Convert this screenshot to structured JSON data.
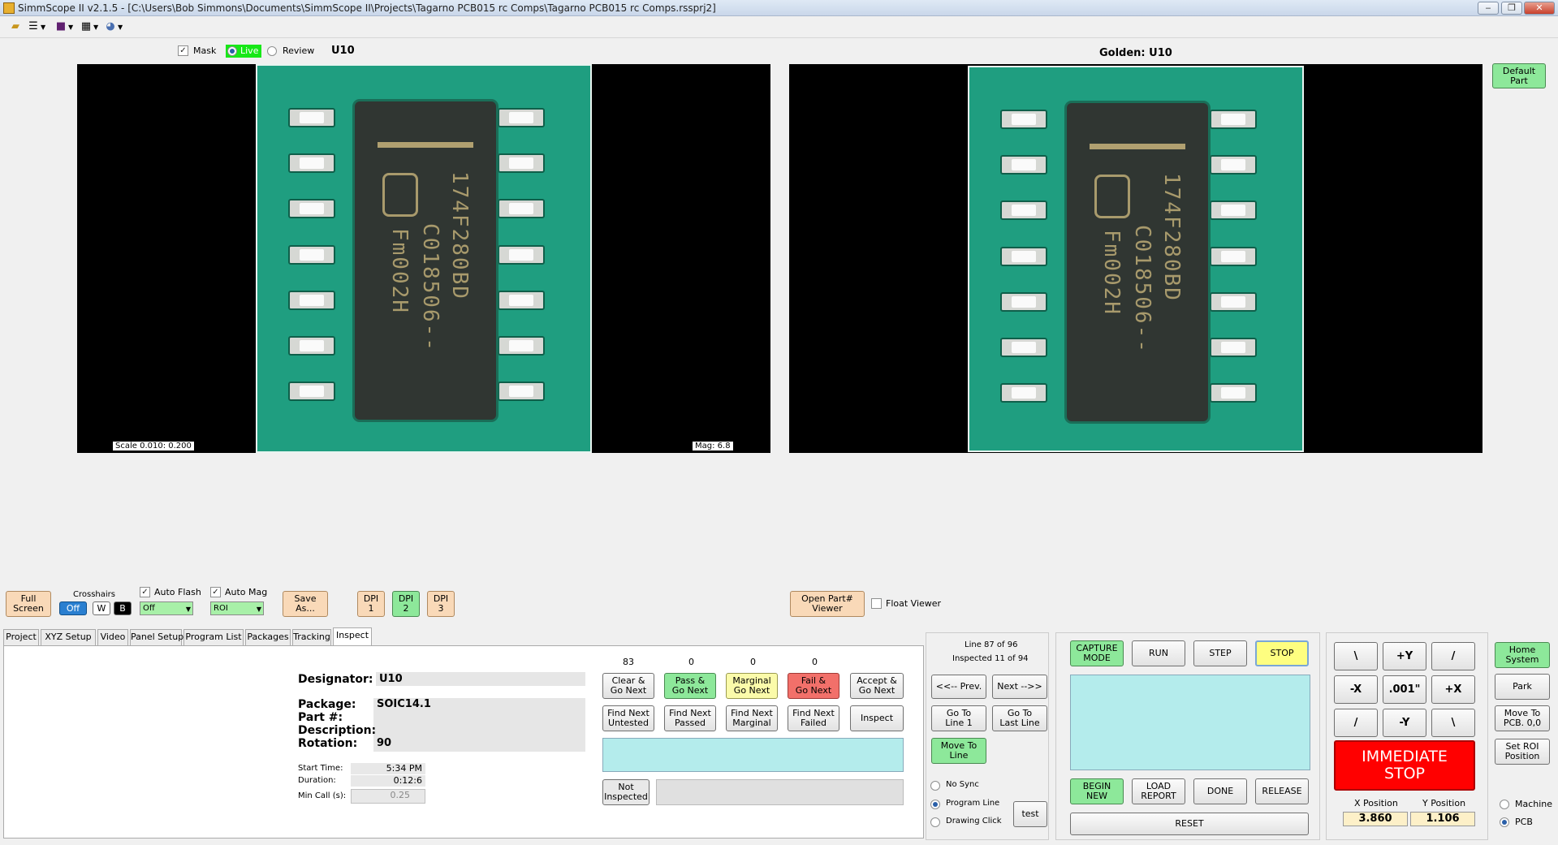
{
  "window": {
    "title": "SimmScope II  v2.1.5 - [C:\\Users\\Bob Simmons\\Documents\\SimmScope II\\Projects\\Tagarno PCB015 rc Comps\\Tagarno PCB015 rc Comps.rssprj2]",
    "minimize": "‒",
    "restore": "❐",
    "close": "✕"
  },
  "toolbar": {
    "icons": [
      "folder-open-icon",
      "checklist-icon",
      "camera-icon",
      "grid-icon",
      "globe-icon"
    ]
  },
  "live_view": {
    "mask_label": "Mask",
    "live_label": "Live",
    "review_label": "Review",
    "designator": "U10",
    "scale": "Scale 0.010:  0.200",
    "mag": "Mag: 6.8"
  },
  "golden_view": {
    "label": "Golden:  U10"
  },
  "chip": {
    "marking_line1": "174F280BD",
    "marking_line2": "C018506--",
    "marking_line3": "Fm002H"
  },
  "default_part": "Default\nPart",
  "controls": {
    "full_screen": "Full\nScreen",
    "crosshairs_label": "Crosshairs",
    "cross_off": "Off",
    "cross_w": "W",
    "cross_b": "B",
    "auto_flash_label": "Auto Flash",
    "auto_flash_value": "Off",
    "auto_mag_label": "Auto Mag",
    "auto_mag_value": "ROI",
    "save_as": "Save\nAs...",
    "dpi1": "DPI\n1",
    "dpi2": "DPI\n2",
    "dpi3": "DPI\n3",
    "open_part_viewer": "Open Part#\nViewer",
    "float_viewer": "Float Viewer"
  },
  "tabs": [
    "Project",
    "XYZ Setup",
    "Video",
    "Panel Setup",
    "Program List",
    "Packages",
    "Tracking",
    "Inspect"
  ],
  "inspect": {
    "designator_label": "Designator:",
    "designator": "U10",
    "package_label": "Package:",
    "package": "SOIC14.1",
    "part_label": "Part #:",
    "part": "",
    "description_label": "Description:",
    "description": "",
    "rotation_label": "Rotation:",
    "rotation": "90",
    "start_label": "Start Time:",
    "start": "5:34 PM",
    "duration_label": "Duration:",
    "duration": "0:12:6",
    "mincall_label": "Min Call (s):",
    "mincall": "0.25"
  },
  "counts": {
    "untested": "83",
    "passed": "0",
    "marginal": "0",
    "failed": "0"
  },
  "actions": {
    "clear_next": "Clear &\nGo Next",
    "pass_next": "Pass &\nGo Next",
    "marginal_next": "Marginal\nGo Next",
    "fail_next": "Fail &\nGo Next",
    "accept_next": "Accept &\nGo Next",
    "find_untested": "Find Next\nUntested",
    "find_passed": "Find Next\nPassed",
    "find_marginal": "Find Next\nMarginal",
    "find_failed": "Find Next\nFailed",
    "inspect": "Inspect",
    "not_inspected": "Not\nInspected"
  },
  "nav": {
    "line_info": "Line 87 of 96",
    "inspected_info": "Inspected 11 of 94",
    "prev": "<<-- Prev.",
    "next": "Next -->>",
    "goto1": "Go To\nLine 1",
    "goto_last": "Go To\nLast Line",
    "move_to_line": "Move To\nLine",
    "no_sync": "No Sync",
    "program_line": "Program Line",
    "drawing_click": "Drawing Click",
    "test": "test"
  },
  "run": {
    "capture_mode": "CAPTURE\nMODE",
    "run": "RUN",
    "step": "STEP",
    "stop": "STOP",
    "begin_new": "BEGIN\nNEW",
    "load_report": "LOAD\nREPORT",
    "done": "DONE",
    "release": "RELEASE",
    "reset": "RESET"
  },
  "jog": {
    "nw": "\\",
    "py": "+Y",
    "ne": "/",
    "mx": "-X",
    "step": ".001\"",
    "px": "+X",
    "sw": "/",
    "my": "-Y",
    "se": "\\",
    "immediate_stop": "IMMEDIATE\nSTOP",
    "x_label": "X Position",
    "x_value": "3.860",
    "y_label": "Y Position",
    "y_value": "1.106"
  },
  "system": {
    "home": "Home\nSystem",
    "park": "Park",
    "move_pcb": "Move To\nPCB. 0,0",
    "set_roi": "Set ROI\nPosition",
    "machine": "Machine",
    "pcb": "PCB"
  },
  "colors": {
    "board": "#1f9e80",
    "live_green": "#17e817",
    "accent_green": "#8de89a",
    "cyan_panel": "#b4ecec",
    "stop_red": "#ff0000"
  }
}
